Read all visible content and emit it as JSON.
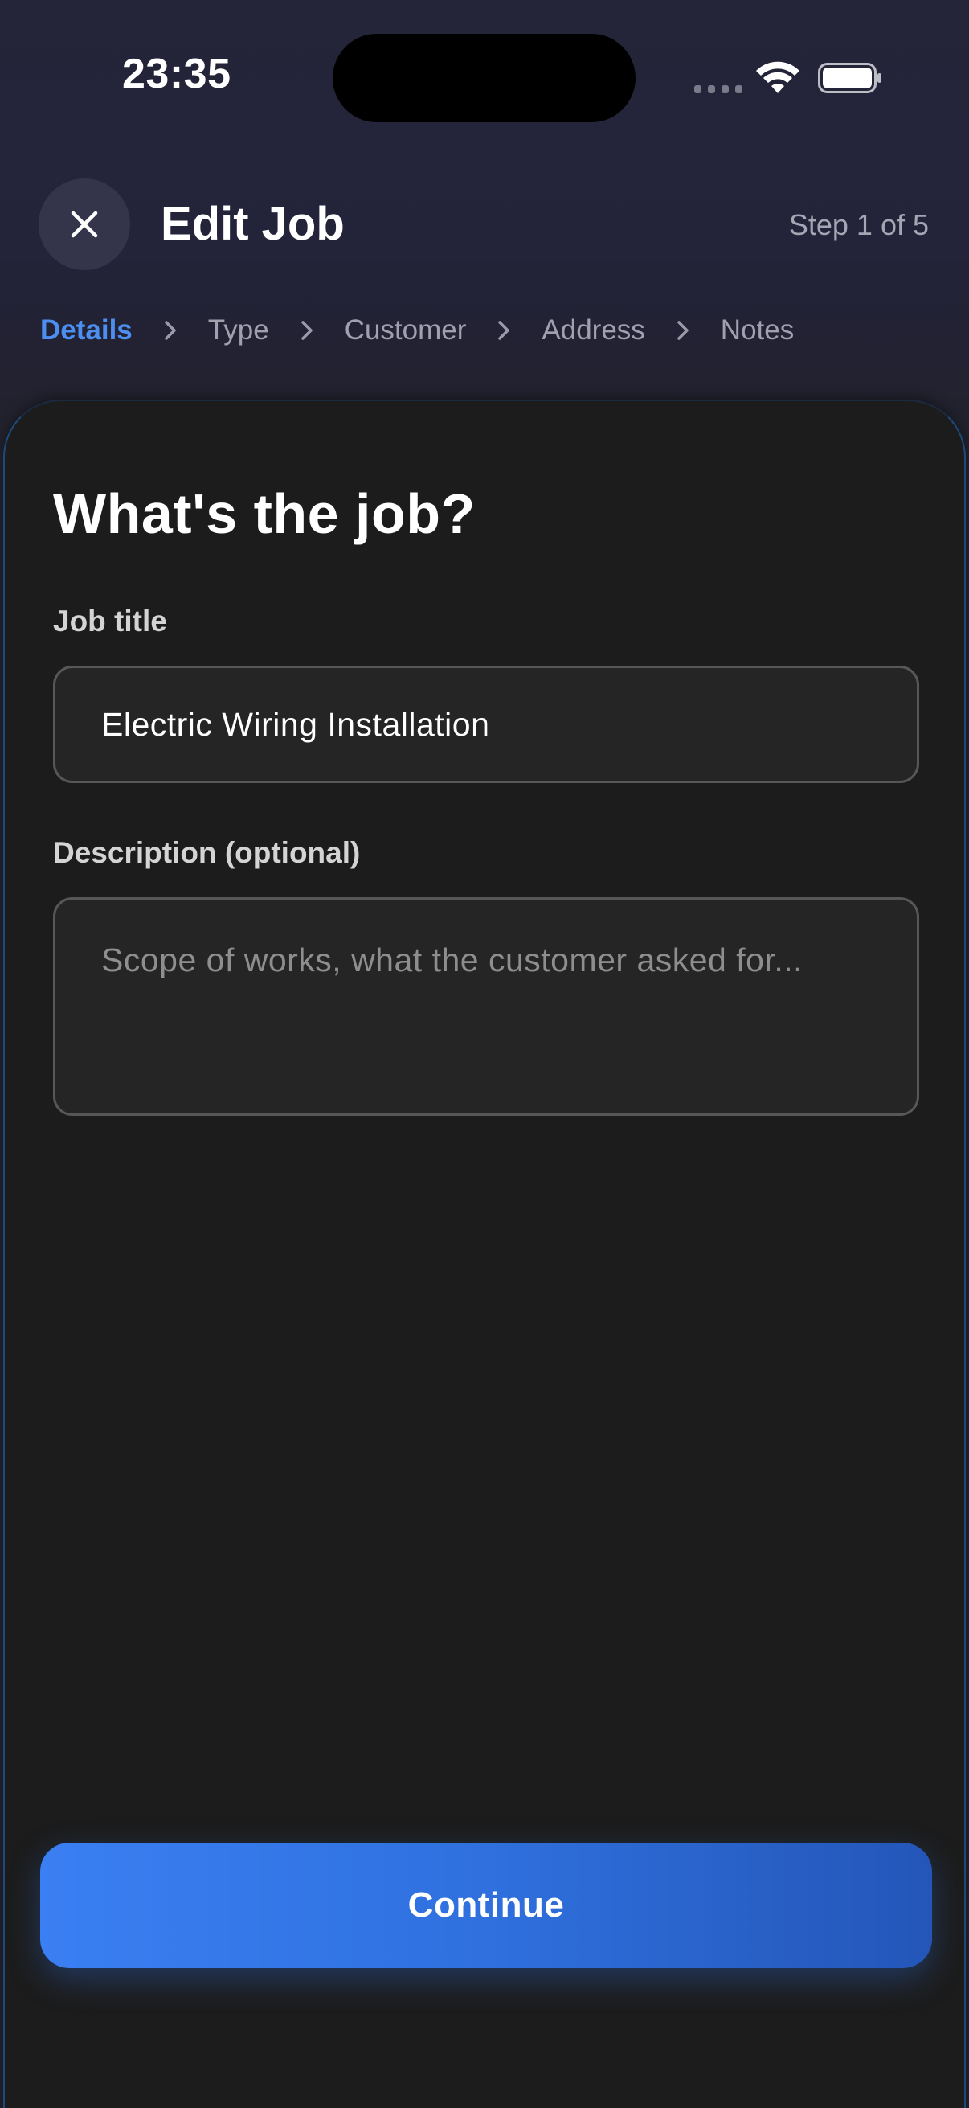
{
  "status_bar": {
    "time": "23:35"
  },
  "header": {
    "close_icon": "close-icon",
    "title": "Edit Job",
    "step": "Step 1 of 5"
  },
  "breadcrumb": {
    "items": [
      {
        "label": "Details",
        "active": true
      },
      {
        "label": "Type",
        "active": false
      },
      {
        "label": "Customer",
        "active": false
      },
      {
        "label": "Address",
        "active": false
      },
      {
        "label": "Notes",
        "active": false
      }
    ],
    "separator_icon": "chevron-right-icon"
  },
  "form": {
    "heading": "What's the job?",
    "job_title": {
      "label": "Job title",
      "value": "Electric Wiring Installation"
    },
    "description": {
      "label": "Description (optional)",
      "value": "",
      "placeholder": "Scope of works, what the customer asked for..."
    }
  },
  "actions": {
    "continue_label": "Continue"
  },
  "colors": {
    "accent": "#3a7ff3",
    "active_breadcrumb": "#4c8ff0",
    "sheet_background": "#1c1c1c",
    "header_background": "#24243a"
  }
}
